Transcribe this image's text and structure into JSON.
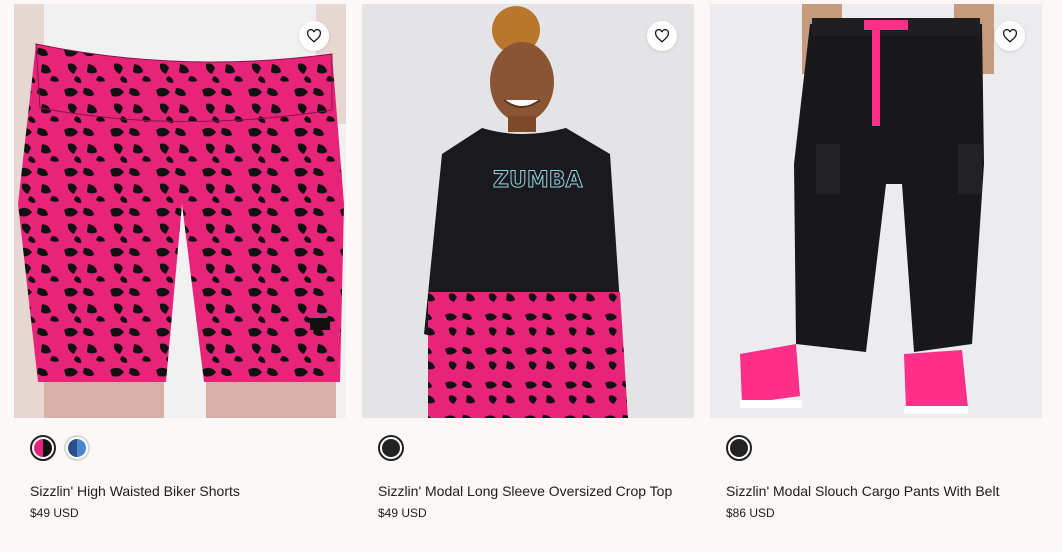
{
  "products": [
    {
      "name": "Sizzlin' High Waisted Biker Shorts",
      "price": "$49 USD",
      "swatches": [
        {
          "colors": [
            "#e8237a",
            "#111111"
          ],
          "selected": true
        },
        {
          "colors": [
            "#2b4f8c",
            "#4a86cf"
          ],
          "selected": false
        }
      ],
      "wishlist_icon": "heart-outline-icon"
    },
    {
      "name": "Sizzlin' Modal Long Sleeve Oversized Crop Top",
      "price": "$49 USD",
      "swatches": [
        {
          "colors": [
            "#222222",
            "#222222"
          ],
          "selected": true
        }
      ],
      "wishlist_icon": "heart-outline-icon",
      "shirt_logo": "ZUMBA"
    },
    {
      "name": "Sizzlin' Modal Slouch Cargo Pants With Belt",
      "price": "$86 USD",
      "swatches": [
        {
          "colors": [
            "#222222",
            "#222222"
          ],
          "selected": true
        }
      ],
      "wishlist_icon": "heart-outline-icon"
    }
  ],
  "colors": {
    "page_bg": "#fbf8f6",
    "hot_pink": "#e8237a",
    "black": "#111111"
  }
}
